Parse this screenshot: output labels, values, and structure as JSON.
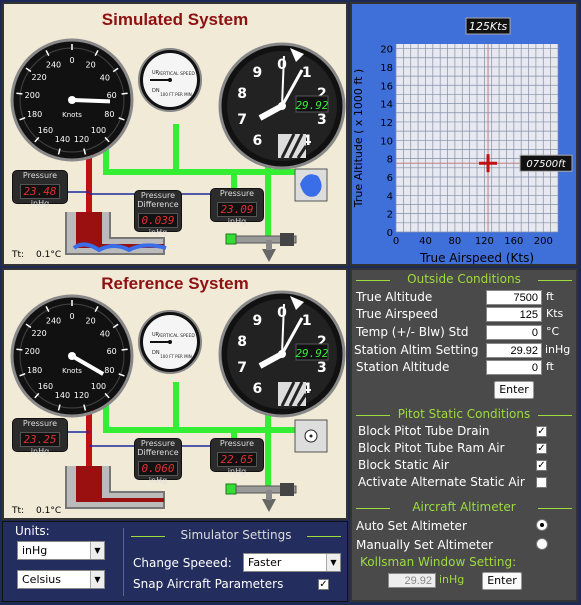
{
  "simulated": {
    "title": "Simulated System",
    "airspeed_unit": "Knots",
    "airspeed_ticks": [
      "0",
      "20",
      "40",
      "60",
      "80",
      "100",
      "120",
      "140",
      "160",
      "180",
      "200",
      "220",
      "240"
    ],
    "vsi_label": "VERTICAL SPEED",
    "vsi_unit": "100 FT PER MIN",
    "vsi_ticks": [
      "UP",
      "DN",
      ".5",
      "1",
      "2"
    ],
    "altimeter_ticks": [
      "0",
      "1",
      "2",
      "3",
      "4",
      "5",
      "6",
      "7",
      "8",
      "9"
    ],
    "kollsman": "29.92",
    "pitot_label": "Pressure",
    "pitot_value": "23.48",
    "pitot_unit": "inHg",
    "diff_label_1": "Pressure",
    "diff_label_2": "Difference",
    "diff_value": "0.039",
    "diff_unit": "inHg",
    "static_label": "Pressure",
    "static_value": "23.09",
    "static_unit": "inHg",
    "tt_label": "Tt:",
    "tt_value": "0.1°C"
  },
  "reference": {
    "title": "Reference System",
    "airspeed_unit": "Knots",
    "airspeed_ticks": [
      "0",
      "20",
      "40",
      "60",
      "80",
      "100",
      "120",
      "140",
      "160",
      "180",
      "200",
      "220",
      "240"
    ],
    "vsi_label": "VERTICAL SPEED",
    "vsi_unit": "100 FT PER MIN",
    "vsi_ticks": [
      "UP",
      "DN",
      ".5",
      "1",
      "2"
    ],
    "altimeter_ticks": [
      "0",
      "1",
      "2",
      "3",
      "4",
      "5",
      "6",
      "7",
      "8",
      "9"
    ],
    "kollsman": "29.92",
    "pitot_label": "Pressure",
    "pitot_value": "23.25",
    "pitot_unit": "inHg",
    "diff_label_1": "Pressure",
    "diff_label_2": "Difference",
    "diff_value": "0.060",
    "diff_unit": "inHg",
    "static_label": "Pressure",
    "static_value": "22.65",
    "static_unit": "inHg",
    "tt_label": "Tt:",
    "tt_value": "0.1°C"
  },
  "graph": {
    "airspeed_readout": "125Kts",
    "altitude_readout": "07500ft",
    "x_ticks": [
      "0",
      "40",
      "80",
      "120",
      "160",
      "200"
    ],
    "y_ticks": [
      "0",
      "2",
      "4",
      "6",
      "8",
      "10",
      "12",
      "14",
      "16",
      "18",
      "20"
    ],
    "x_label": "True Airspeed (Kts)",
    "y_label": "True Altitude  ( x 1000 ft )",
    "marker_airspeed": 125,
    "marker_altitude": 7.5
  },
  "outside_conditions": {
    "heading": "Outside Conditions",
    "true_altitude_label": "True Altitude",
    "true_altitude_value": "7500",
    "true_altitude_unit": "ft",
    "true_airspeed_label": "True Airspeed",
    "true_airspeed_value": "125",
    "true_airspeed_unit": "Kts",
    "temp_label": "Temp (+/- Blw) Std",
    "temp_value": "0",
    "temp_unit": "°C",
    "station_altim_label": "Station Altim Setting",
    "station_altim_value": "29.92",
    "station_altim_unit": "inHg",
    "station_alt_label": "Station Altitude",
    "station_alt_value": "0",
    "station_alt_unit": "ft",
    "enter_label": "Enter"
  },
  "pitot_static_conditions": {
    "heading": "Pitot Static Conditions",
    "items": [
      {
        "label": "Block Pitot Tube Drain",
        "checked": true
      },
      {
        "label": "Block Pitot Tube Ram Air",
        "checked": true
      },
      {
        "label": "Block Static Air",
        "checked": true
      },
      {
        "label": "Activate Alternate Static Air",
        "checked": false
      }
    ]
  },
  "aircraft_altimeter": {
    "heading": "Aircraft Altimeter",
    "auto_label": "Auto Set Altimeter",
    "manual_label": "Manually Set Altimeter",
    "kollsman_label": "Kollsman Window Setting:",
    "kollsman_value": "29.92",
    "kollsman_unit": "inHg",
    "enter_label": "Enter"
  },
  "bottom": {
    "units_label": "Units:",
    "pressure_unit": "inHg",
    "temp_unit": "Celsius",
    "sim_settings_label": "Simulator Settings",
    "change_speed_label": "Change Speeed:",
    "change_speed_value": "Faster",
    "snap_label": "Snap Aircraft Parameters",
    "snap_checked": true
  },
  "colors": {
    "title_red": "#8e1010",
    "tube_green": "#33ee33",
    "tube_red": "#c01010",
    "graph_blue": "#3f6fd8",
    "heading_green": "#9ddc3d"
  }
}
